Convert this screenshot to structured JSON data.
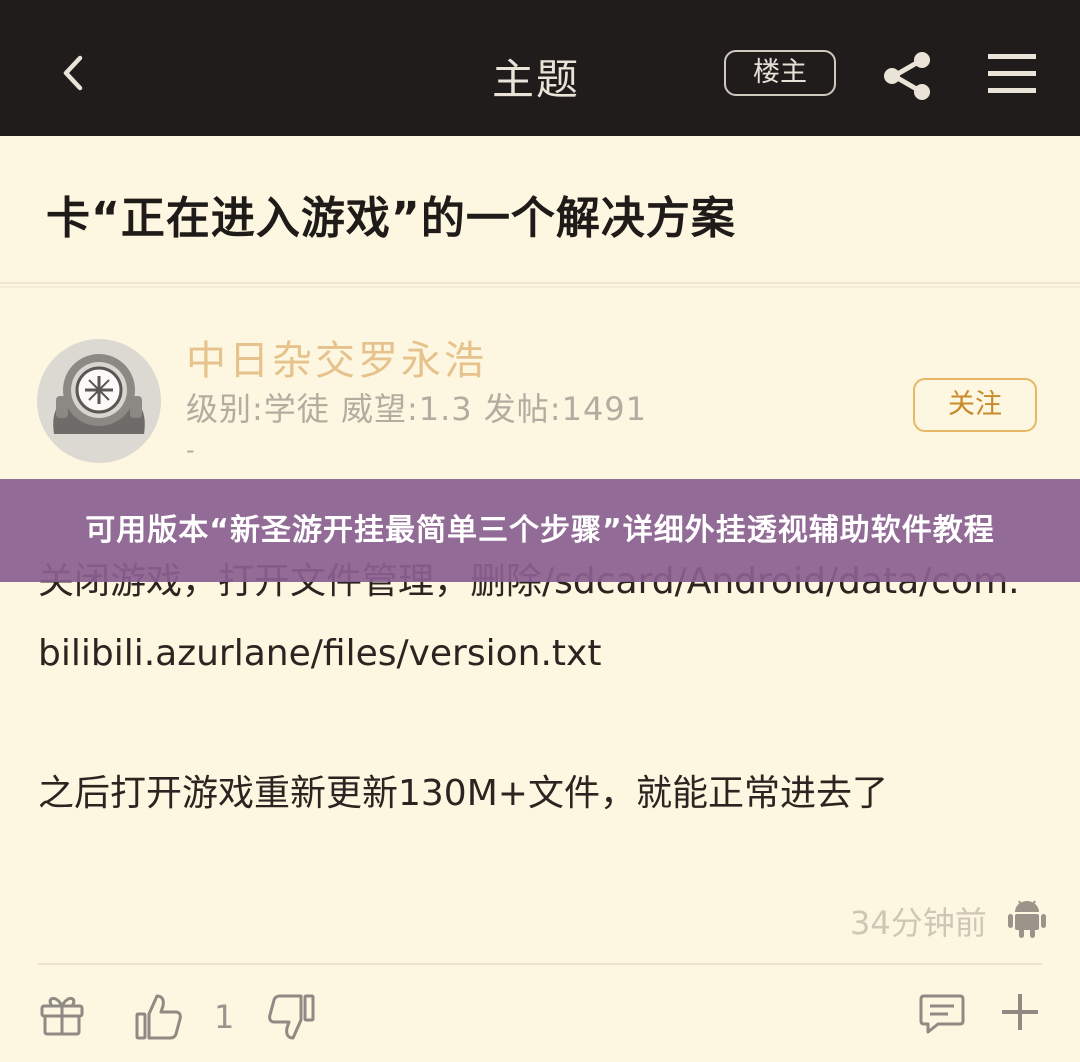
{
  "header": {
    "title": "主题",
    "op_label": "楼主",
    "icons": {
      "back": "chevron-left-icon",
      "share": "share-icon",
      "menu": "menu-icon"
    }
  },
  "post": {
    "title": "卡“正在进入游戏”的一个解决方案",
    "author": {
      "name": "中日杂交罗永浩",
      "meta": "级别:学徒 威望:1.3 发帖:1491",
      "signature": "-",
      "follow_label": "关注"
    },
    "body": {
      "paragraph1": "关闭游戏，打开文件管理，删除/sdcard/Android/data/com.bilibili.azurlane/files/version.txt",
      "paragraph2": "之后打开游戏重新更新130M+文件，就能正常进去了"
    },
    "time": "34分钟前",
    "likes": "1"
  },
  "overlay": {
    "text": "可用版本“新圣游开挂最简单三个步骤”详细外挂透视辅助软件教程"
  },
  "colors": {
    "header_bg": "#201c1b",
    "page_bg": "#fdf6e0",
    "username": "#e6c28c",
    "follow_border": "#e6b866",
    "overlay_bg": "#8a6091"
  }
}
